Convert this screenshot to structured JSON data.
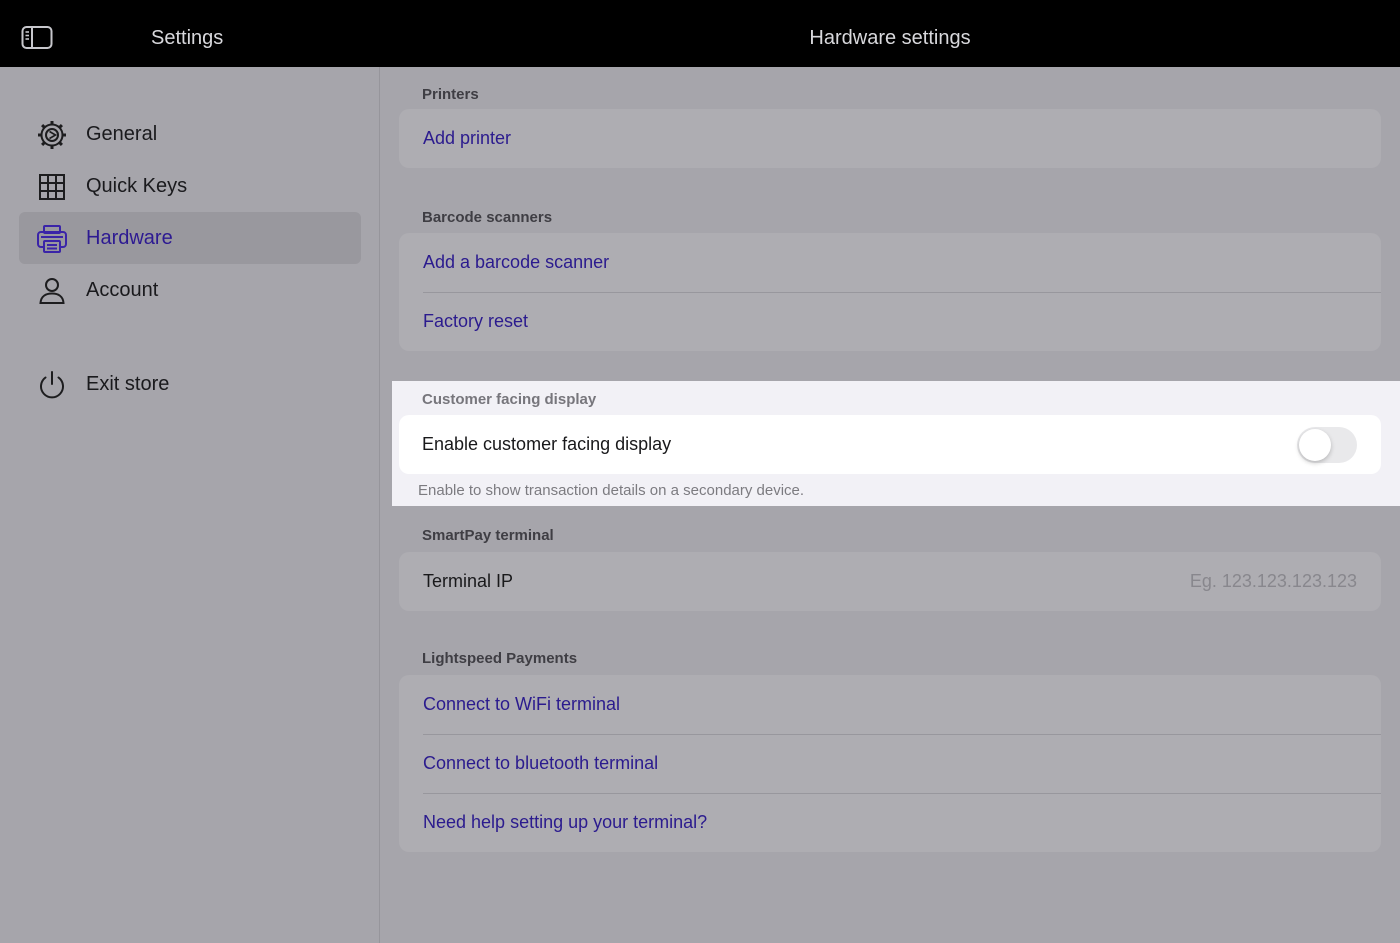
{
  "topbar": {
    "sidebar_title": "Settings",
    "page_title": "Hardware settings",
    "toggle_icon": "sidebar-toggle-icon"
  },
  "sidebar": {
    "items": [
      {
        "label": "General",
        "icon": "gear-icon",
        "active": false
      },
      {
        "label": "Quick Keys",
        "icon": "grid-icon",
        "active": false
      },
      {
        "label": "Hardware",
        "icon": "printer-icon",
        "active": true
      },
      {
        "label": "Account",
        "icon": "person-icon",
        "active": false
      },
      {
        "label": "Exit store",
        "icon": "power-icon",
        "active": false
      }
    ]
  },
  "main": {
    "printers": {
      "title": "Printers",
      "add_printer": "Add printer"
    },
    "barcode_scanners": {
      "title": "Barcode scanners",
      "add_scanner": "Add a barcode scanner",
      "factory_reset": "Factory reset"
    },
    "customer_display": {
      "title": "Customer facing display",
      "toggle_label": "Enable customer facing display",
      "enabled": false,
      "helper": "Enable to show transaction details on a secondary device."
    },
    "smartpay": {
      "title": "SmartPay terminal",
      "terminal_ip_label": "Terminal IP",
      "terminal_ip_value": "",
      "terminal_ip_placeholder": "Eg. 123.123.123.123"
    },
    "lightspeed_payments": {
      "title": "Lightspeed Payments",
      "wifi": "Connect to WiFi terminal",
      "bluetooth": "Connect to bluetooth terminal",
      "help": "Need help setting up your terminal?"
    }
  },
  "colors": {
    "accent": "#2d1a92",
    "topbar": "#000000",
    "dimmed_background": "#a6a5ab",
    "highlight_background": "#f2f1f6"
  }
}
